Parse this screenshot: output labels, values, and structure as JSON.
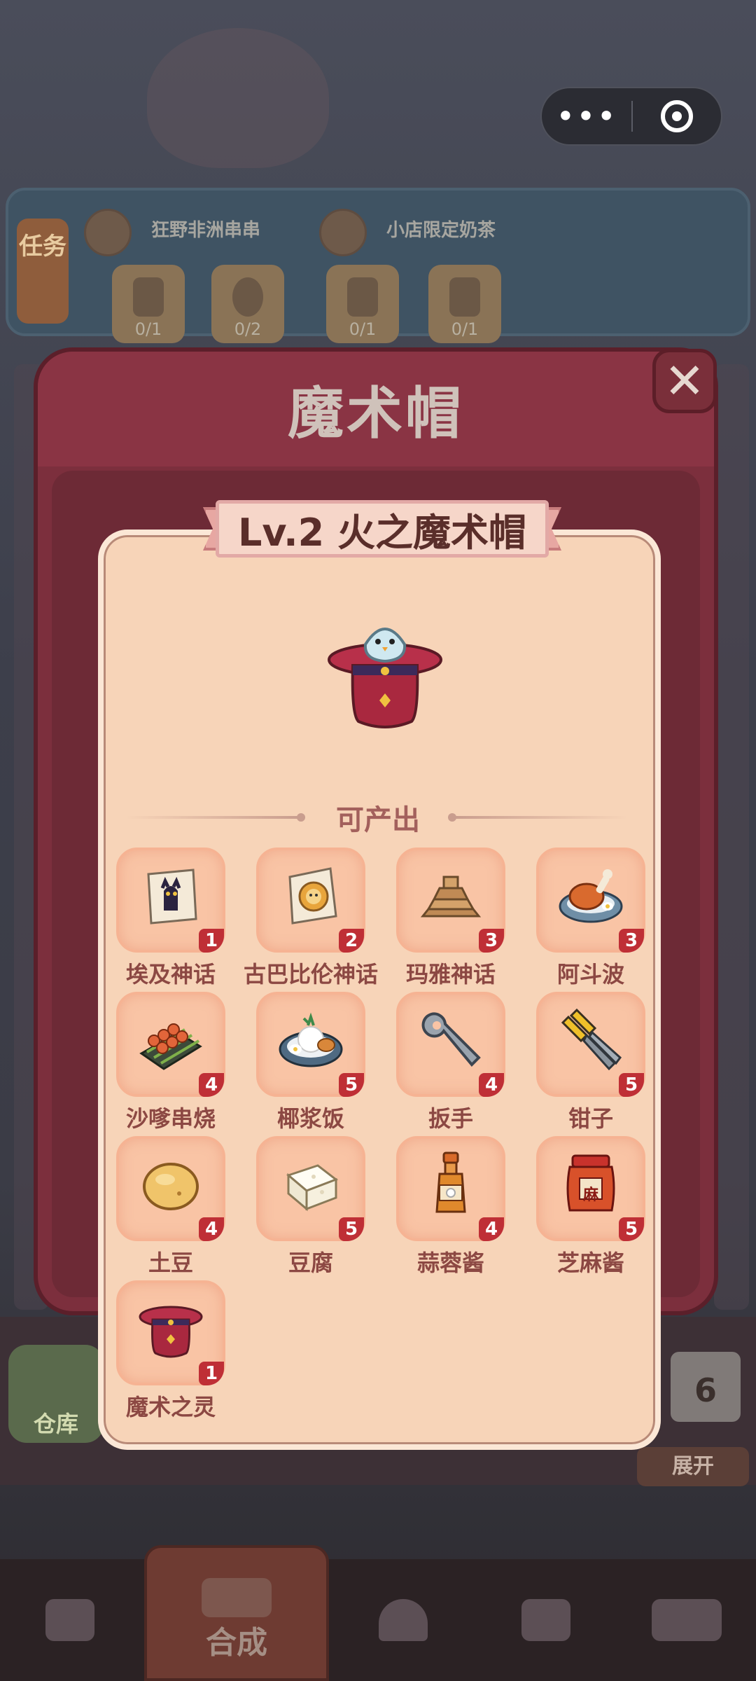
{
  "top_capsule": {
    "more_glyph": "•••",
    "target_icon": "target-icon"
  },
  "task_bar": {
    "tab_label": "任务",
    "groups": [
      {
        "title": "狂野非洲串串",
        "slots": [
          "0/1",
          "0/2"
        ]
      },
      {
        "title": "小店限定奶茶",
        "slots": [
          "0/1",
          "0/1"
        ]
      }
    ]
  },
  "panel": {
    "title": "魔术帽",
    "close_glyph": "✕"
  },
  "card": {
    "ribbon_text": "Lv.2 火之魔术帽",
    "produce_label": "可产出",
    "items": [
      {
        "name": "埃及神话",
        "level": "1",
        "icon": "egypt-scroll-icon"
      },
      {
        "name": "古巴比伦神话",
        "level": "2",
        "icon": "babylon-scroll-icon"
      },
      {
        "name": "玛雅神话",
        "level": "3",
        "icon": "maya-pyramid-icon"
      },
      {
        "name": "阿斗波",
        "level": "3",
        "icon": "roast-chicken-plate-icon"
      },
      {
        "name": "沙嗲串烧",
        "level": "4",
        "icon": "satay-skewers-icon"
      },
      {
        "name": "椰浆饭",
        "level": "5",
        "icon": "coconut-rice-icon"
      },
      {
        "name": "扳手",
        "level": "4",
        "icon": "wrench-icon"
      },
      {
        "name": "钳子",
        "level": "5",
        "icon": "pliers-icon"
      },
      {
        "name": "土豆",
        "level": "4",
        "icon": "potato-icon"
      },
      {
        "name": "豆腐",
        "level": "5",
        "icon": "tofu-icon"
      },
      {
        "name": "蒜蓉酱",
        "level": "4",
        "icon": "garlic-sauce-bottle-icon"
      },
      {
        "name": "芝麻酱",
        "level": "5",
        "icon": "sesame-paste-jar-icon"
      },
      {
        "name": "魔术之灵",
        "level": "1",
        "icon": "magic-hat-icon"
      }
    ],
    "jar_label": "麻"
  },
  "background": {
    "warehouse_label": "仓库",
    "expand_label": "展开",
    "calendar_day": "6"
  },
  "bottom_nav": {
    "active_label": "合成",
    "items": [
      "bag-icon",
      "merge-icon",
      "bell-icon",
      "chef-icon",
      "bus-icon"
    ]
  },
  "colors": {
    "panel": "#7c2f3d",
    "card": "#f7d4b8",
    "slot": "#f9c4a5",
    "level_badge": "#bf2f36",
    "item_text": "#8c4843"
  }
}
